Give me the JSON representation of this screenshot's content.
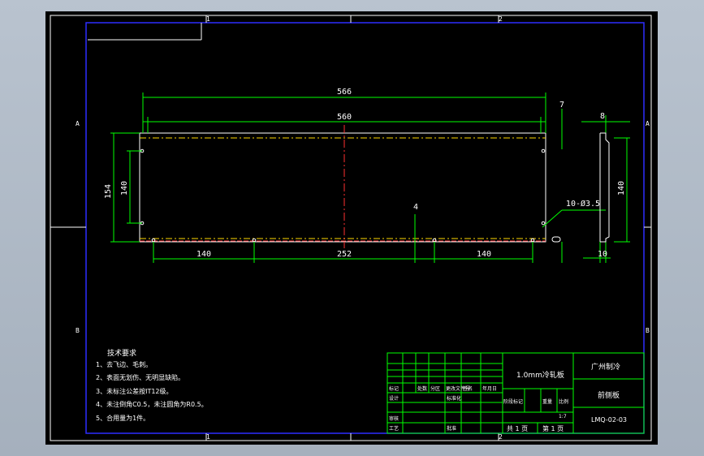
{
  "border": {
    "zone_numbers": [
      "1",
      "2"
    ],
    "zone_letters_left": [
      "A",
      "B"
    ],
    "zone_letters_right": [
      "A",
      "B"
    ]
  },
  "dimensions": {
    "overall_width": "566",
    "inner_width": "560",
    "offset_top": "7",
    "height_outer": "154",
    "height_inner": "140",
    "left_spacing": "140",
    "middle_spacing": "252",
    "right_spacing": "140",
    "small_offset": "4",
    "hole_callout": "10-Ø3.5",
    "side_top": "8",
    "side_height": "140",
    "side_bottom": "10"
  },
  "notes": {
    "title": "技术要求",
    "items": [
      "1、去飞边、毛刺。",
      "2、表面无划伤、无明显缺陷。",
      "3、未标注公差按IT12级。",
      "4、未注倒角C0.5，未注圆角为R0.5。",
      "5、合用量为1件。"
    ]
  },
  "title_block": {
    "material": "1.0mm冷轧板",
    "company": "广州制冷",
    "part_name": "前侧板",
    "drawing_no": "LMQ-02-03",
    "scale": "1:7",
    "sheet_info": [
      "共 1 页",
      "第 1 页"
    ],
    "headers": [
      "标记",
      "处数",
      "分区",
      "更改文件号",
      "签名",
      "年月日"
    ],
    "role_labels": [
      "设计",
      "审核",
      "工艺"
    ],
    "mid_labels": [
      "标准化",
      "批准"
    ],
    "stage_labels": [
      "阶段标记",
      "重量",
      "比例"
    ]
  }
}
